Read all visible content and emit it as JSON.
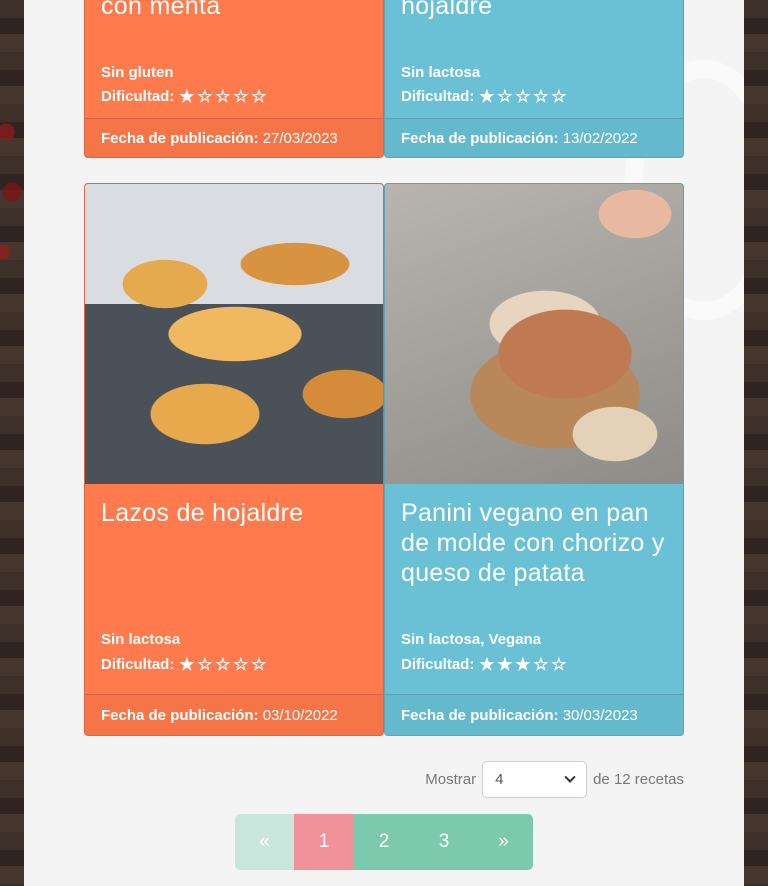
{
  "colors": {
    "card_orange": "#ff7a4d",
    "card_blue": "#6ac1d6",
    "pagination_green": "#7cc9ad",
    "pagination_active": "#f1929a"
  },
  "top_cards": [
    {
      "title": "Trufas de chocolate con menta",
      "tags": "Sin gluten",
      "difficulty_label": "Dificultad:",
      "difficulty_level": 1,
      "date_label": "Fecha de publicación:",
      "date": "27/03/2023"
    },
    {
      "title": "Coca de mollitas de hojaldre",
      "tags": "Sin lactosa",
      "difficulty_label": "Dificultad:",
      "difficulty_level": 1,
      "date_label": "Fecha de publicación:",
      "date": "13/02/2022"
    }
  ],
  "cards": [
    {
      "title": "Lazos de hojaldre",
      "tags": "Sin lactosa",
      "difficulty_label": "Dificultad:",
      "difficulty_level": 1,
      "date_label": "Fecha de publicación:",
      "date": "03/10/2022"
    },
    {
      "title": "Panini vegano en pan de molde con chorizo y queso de patata",
      "tags": "Sin lactosa, Vegana",
      "difficulty_label": "Dificultad:",
      "difficulty_level": 3,
      "date_label": "Fecha de publicación:",
      "date": "30/03/2023"
    }
  ],
  "difficulty_max": 5,
  "icons": {
    "star_filled": "star-filled-icon",
    "star_empty": "star-empty-icon",
    "chevron": "chevron-down-icon"
  },
  "paging": {
    "show_label": "Mostrar",
    "per_page": "4",
    "total_label": "de 12 recetas",
    "prev": "«",
    "pages": [
      "1",
      "2",
      "3"
    ],
    "next": "»",
    "current_page": "1"
  }
}
